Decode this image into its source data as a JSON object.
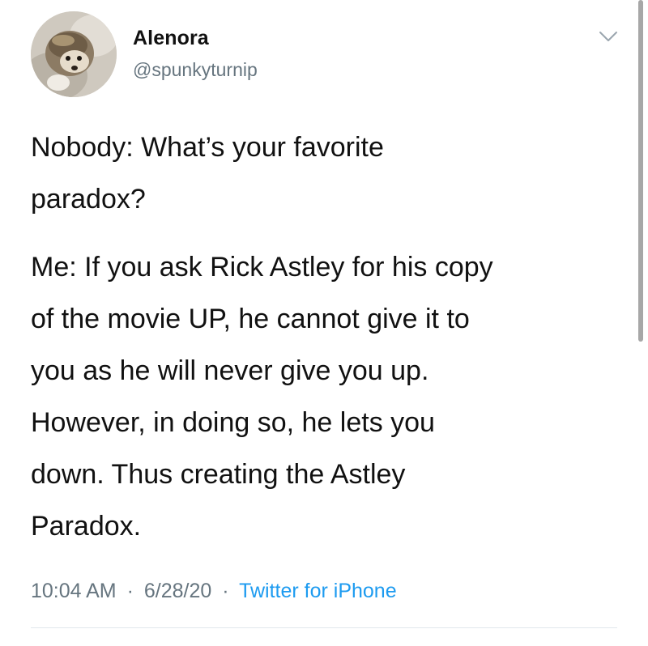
{
  "tweet": {
    "author": {
      "display_name": "Alenora",
      "handle": "@spunkyturnip"
    },
    "body": {
      "paragraph1": [
        "Nobody: What’s your favorite",
        "paradox?"
      ],
      "paragraph2": [
        "Me: If you ask Rick Astley for his copy",
        "of the movie UP, he cannot give it to",
        "you as he will never give you up.",
        "However, in doing so, he lets you",
        "down. Thus creating the Astley",
        "Paradox."
      ]
    },
    "meta": {
      "time": "10:04 AM",
      "separator": "·",
      "date": "6/28/20",
      "source": "Twitter for iPhone"
    }
  },
  "icons": {
    "menu": "chevron-down-icon",
    "avatar": "hedgehog-avatar"
  },
  "colors": {
    "text": "#111111",
    "secondary": "#66757f",
    "link": "#1d9bf0",
    "divider": "#e1e8ed",
    "background": "#ffffff"
  }
}
